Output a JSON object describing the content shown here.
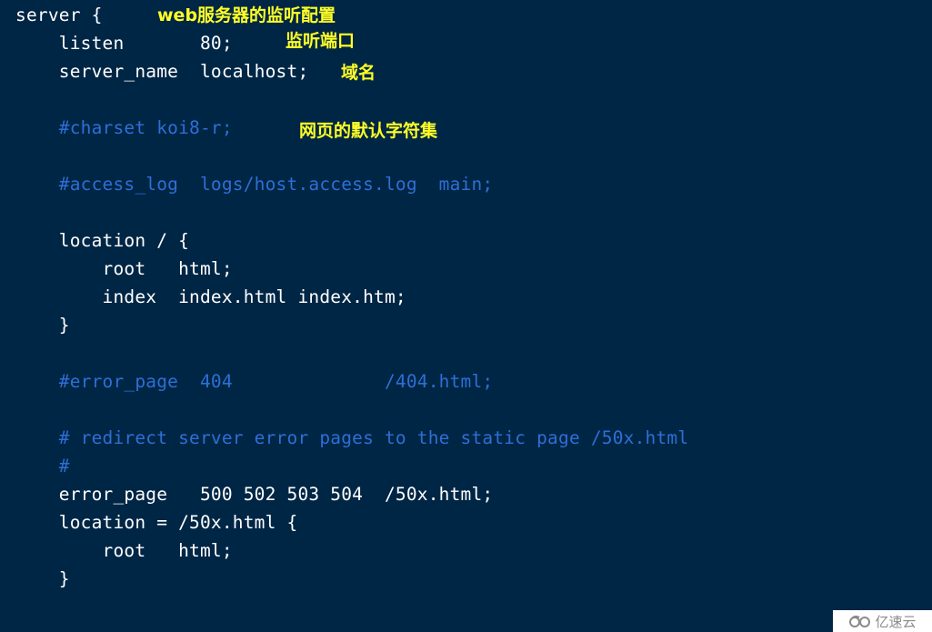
{
  "code_lines": [
    {
      "text": "server {",
      "type": "code"
    },
    {
      "text": "    listen       80;",
      "type": "code"
    },
    {
      "text": "    server_name  localhost;",
      "type": "code"
    },
    {
      "text": "",
      "type": "blank"
    },
    {
      "text": "    #charset koi8-r;",
      "type": "comment"
    },
    {
      "text": "",
      "type": "blank"
    },
    {
      "text": "    #access_log  logs/host.access.log  main;",
      "type": "comment"
    },
    {
      "text": "",
      "type": "blank"
    },
    {
      "text": "    location / {",
      "type": "code"
    },
    {
      "text": "        root   html;",
      "type": "code"
    },
    {
      "text": "        index  index.html index.htm;",
      "type": "code"
    },
    {
      "text": "    }",
      "type": "code"
    },
    {
      "text": "",
      "type": "blank"
    },
    {
      "text": "    #error_page  404              /404.html;",
      "type": "comment"
    },
    {
      "text": "",
      "type": "blank"
    },
    {
      "text": "    # redirect server error pages to the static page /50x.html",
      "type": "comment"
    },
    {
      "text": "    #",
      "type": "comment"
    },
    {
      "text": "    error_page   500 502 503 504  /50x.html;",
      "type": "code"
    },
    {
      "text": "    location = /50x.html {",
      "type": "code"
    },
    {
      "text": "        root   html;",
      "type": "code"
    },
    {
      "text": "    }",
      "type": "code"
    }
  ],
  "annotations": {
    "server": "web服务器的监听配置",
    "listen": "监听端口",
    "server_name": "域名",
    "charset": "网页的默认字符集"
  },
  "watermark": {
    "text": "亿速云",
    "icon": "cloud-logo-icon"
  },
  "colors": {
    "background": "#002645",
    "code_text": "#ffffff",
    "comment_text": "#2e6fd6",
    "annotation_text": "#ffff26"
  }
}
